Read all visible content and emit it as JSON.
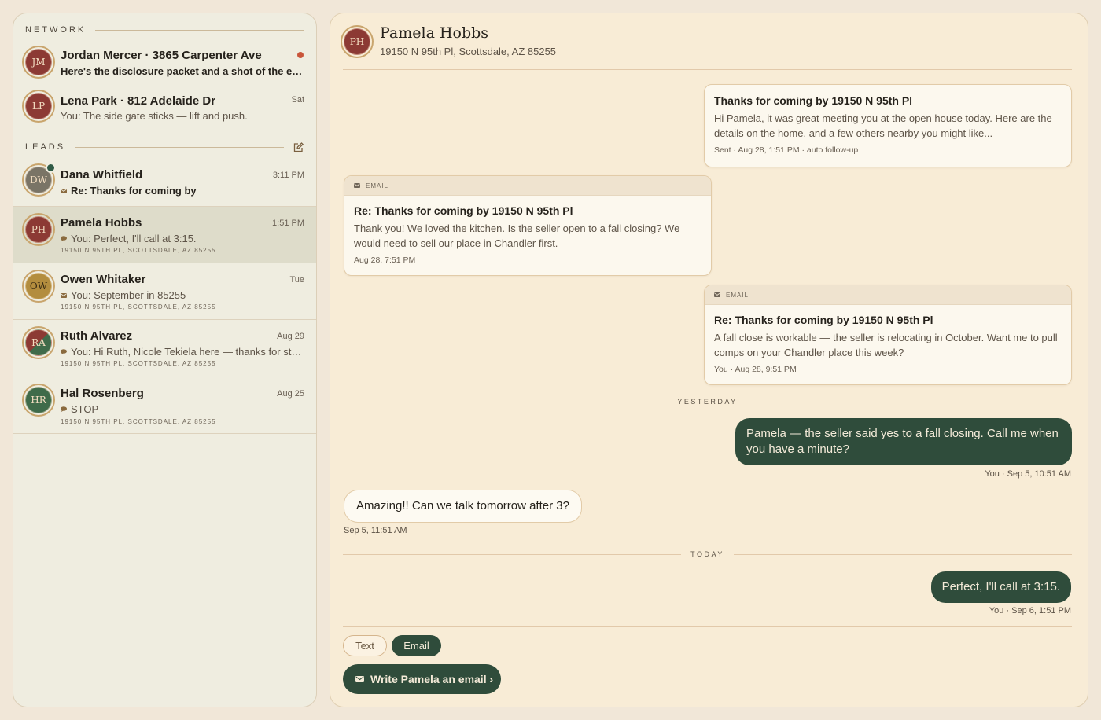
{
  "sidebar": {
    "network_label": "NETWORK",
    "leads_label": "LEADS",
    "network": [
      {
        "initials": "JM",
        "color": "#8c3a34",
        "name": "Jordan Mercer · 3865 Carpenter Ave",
        "preview": "Here's the disclosure packet and a shot of the entry.",
        "unread": true
      },
      {
        "initials": "LP",
        "color": "#8c3a34",
        "name": "Lena Park · 812 Adelaide Dr",
        "time": "Sat",
        "preview": "You: The side gate sticks — lift and push."
      }
    ],
    "leads": [
      {
        "initials": "DW",
        "color": "#7a7466",
        "name": "Dana Whitfield",
        "time": "3:11 PM",
        "channel_icon": "envelope-icon",
        "preview": "Re: Thanks for coming by",
        "online": true
      },
      {
        "initials": "PH",
        "color": "#8c3a34",
        "name": "Pamela Hobbs",
        "time": "1:51 PM",
        "channel_icon": "chat-icon",
        "preview": "You: Perfect, I'll call at 3:15.",
        "address": "19150 N 95TH PL, SCOTTSDALE, AZ 85255",
        "selected": true
      },
      {
        "initials": "OW",
        "color": "#b38d3e",
        "name": "Owen Whitaker",
        "time": "Tue",
        "channel_icon": "envelope-icon",
        "preview": "You: September in 85255",
        "address": "19150 N 95TH PL, SCOTTSDALE, AZ 85255"
      },
      {
        "initials": "RA",
        "color": "#8c3a34",
        "name": "Ruth Alvarez",
        "time": "Aug 29",
        "channel_icon": "chat-icon",
        "preview": "You: Hi Ruth, Nicole Tekiela here — thanks for stopping by today.",
        "address": "19150 N 95TH PL, SCOTTSDALE, AZ 85255"
      },
      {
        "initials": "HR",
        "color": "#3f6b4a",
        "name": "Hal Rosenberg",
        "time": "Aug 25",
        "channel_icon": "chat-icon",
        "preview": "STOP",
        "address": "19150 N 95TH PL, SCOTTSDALE, AZ 85255"
      }
    ]
  },
  "thread": {
    "header": {
      "initials": "PH",
      "name": "Pamela Hobbs",
      "address": "19150 N 95th Pl, Scottsdale, AZ 85255"
    },
    "email1": {
      "subject": "Thanks for coming by 19150 N 95th Pl",
      "body": "Hi Pamela, it was great meeting you at the open house today. Here are the details on the home, and a few others nearby you might like...",
      "meta": "Sent · Aug 28, 1:51 PM · auto follow-up"
    },
    "email2": {
      "tag": "EMAIL",
      "subject": "Re: Thanks for coming by 19150 N 95th Pl",
      "body": "Thank you! We loved the kitchen. Is the seller open to a fall closing? We would need to sell our place in Chandler first.",
      "meta": "Aug 28, 7:51 PM"
    },
    "email3": {
      "tag": "EMAIL",
      "subject": "Re: Thanks for coming by 19150 N 95th Pl",
      "body": "A fall close is workable — the seller is relocating in October. Want me to pull comps on your Chandler place this week?",
      "meta": "You · Aug 28, 9:51 PM"
    },
    "sep_yesterday": "YESTERDAY",
    "msg1": {
      "text": "Pamela — the seller said yes to a fall closing. Call me when you have a minute?",
      "meta": "You · Sep 5, 10:51 AM"
    },
    "msg2": {
      "text": "Amazing!! Can we talk tomorrow after 3?",
      "meta": "Sep 5, 11:51 AM"
    },
    "sep_today": "TODAY",
    "msg3": {
      "text": "Perfect, I'll call at 3:15.",
      "meta": "You · Sep 6, 1:51 PM"
    }
  },
  "composer": {
    "text_tab": "Text",
    "email_tab": "Email",
    "write_button": "Write Pamela an email ›"
  },
  "colors": {
    "accent_green": "#2f4c3b",
    "unread_red": "#c9553a",
    "gold_ring": "#c9a56d"
  }
}
